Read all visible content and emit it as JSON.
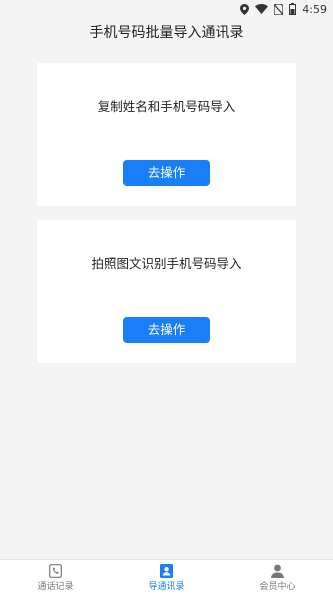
{
  "status_bar": {
    "time": "4:59",
    "icons": [
      "location-icon",
      "wifi-icon",
      "no-sim-icon",
      "battery-icon"
    ]
  },
  "header": {
    "title": "手机号码批量导入通讯录"
  },
  "cards": [
    {
      "text": "复制姓名和手机号码导入",
      "button_label": "去操作"
    },
    {
      "text": "拍照图文识别手机号码导入",
      "button_label": "去操作"
    }
  ],
  "tabbar": {
    "items": [
      {
        "label": "通话记录",
        "icon": "call-log-icon",
        "active": false
      },
      {
        "label": "导通讯录",
        "icon": "contacts-import-icon",
        "active": true
      },
      {
        "label": "会员中心",
        "icon": "user-icon",
        "active": false
      }
    ]
  },
  "colors": {
    "accent": "#1a7ef6",
    "background": "#f4f4f4",
    "card": "#ffffff",
    "inactive_tab": "#777777"
  }
}
